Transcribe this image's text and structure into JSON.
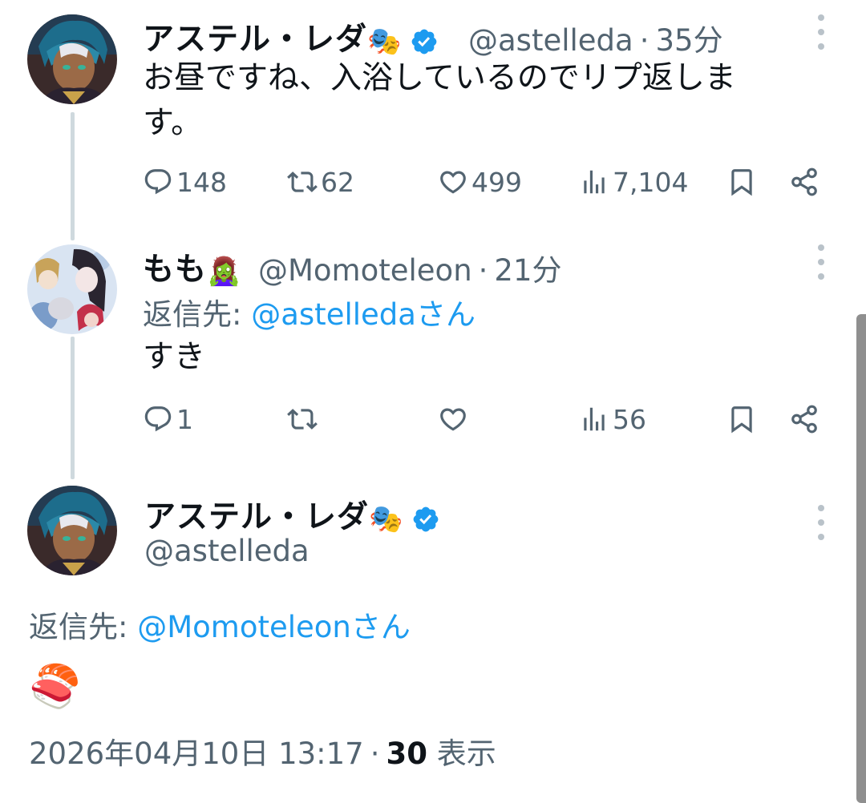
{
  "tweet1": {
    "name": "アステル・レダ",
    "name_emoji": "🎭",
    "handle": "@astelleda",
    "time": "35分",
    "text_line1": "お昼ですね、入浴しているのでリプ返しま",
    "text_line2": "す。",
    "replies": "148",
    "retweets": "62",
    "likes": "499",
    "views": "7,104"
  },
  "tweet2": {
    "name": "もも",
    "name_emoji": "🧟‍♀️",
    "handle": "@Momoteleon",
    "time": "21分",
    "reply_prefix": "返信先: ",
    "reply_target": "@astelledaさん",
    "text": "すき",
    "replies": "1",
    "views": "56"
  },
  "tweet3": {
    "name": "アステル・レダ",
    "name_emoji": "🎭",
    "handle": "@astelleda",
    "reply_prefix": "返信先: ",
    "reply_target": "@Momoteleonさん",
    "text": "🍣",
    "timestamp": "2026年04月10日 13:17",
    "views_count": "30",
    "views_label": "表示"
  },
  "separator": "·",
  "colors": {
    "accent": "#1d9bf0",
    "secondary_text": "#536471",
    "thread_line": "#cfd9de"
  }
}
